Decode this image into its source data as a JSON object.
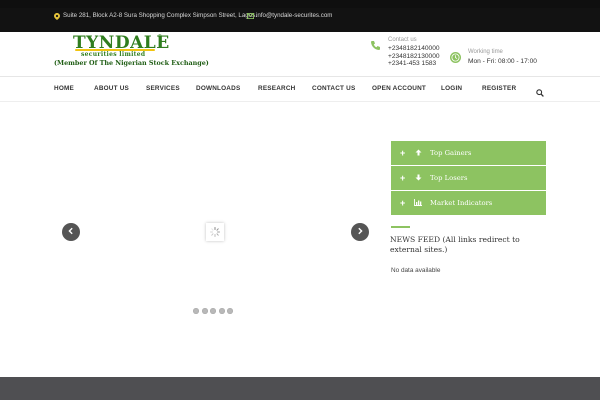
{
  "topbar": {
    "address": "Suite 281, Block A2-8 Sura Shopping Complex Simpson Street, Lagos.",
    "email": "info@tyndale-securites.com"
  },
  "logo": {
    "name": "TYNDALE",
    "reg_mark": "®",
    "subtitle": "securities limited",
    "member": "(Member Of The Nigerian Stock Exchange)"
  },
  "contact": {
    "label": "Contact us",
    "numbers": [
      "+2348182140000",
      "+2348182130000",
      "+2341-453 1583"
    ]
  },
  "working": {
    "label": "Working time",
    "hours": "Mon - Fri: 08:00 - 17:00"
  },
  "nav": {
    "items": [
      "HOME",
      "ABOUT US",
      "SERVICES",
      "DOWNLOADS",
      "RESEARCH",
      "CONTACT US",
      "OPEN ACCOUNT",
      "LOGIN",
      "REGISTER"
    ],
    "search_icon": "search-icon"
  },
  "slider": {
    "prev_icon": "chevron-left-icon",
    "next_icon": "chevron-right-icon",
    "dot_count": 5
  },
  "market_panel": {
    "items": [
      {
        "label": "Top Gainers",
        "icon": "arrow-up-icon",
        "plus": "+"
      },
      {
        "label": "Top Losers",
        "icon": "arrow-down-icon",
        "plus": "+"
      },
      {
        "label": "Market Indicators",
        "icon": "bar-chart-icon",
        "plus": "+"
      }
    ]
  },
  "news": {
    "title": "NEWS FEED (All links redirect to external sites.)",
    "empty": "No data available"
  },
  "colors": {
    "accent_green": "#8dc361",
    "brand_green": "#2f7d1e",
    "topbar_bg": "#121212",
    "footer_bg": "#4f4f52"
  }
}
